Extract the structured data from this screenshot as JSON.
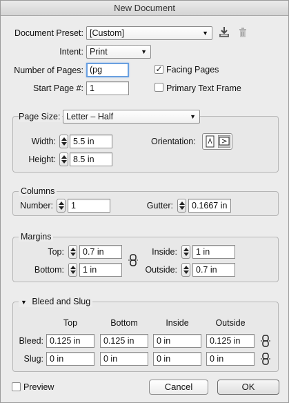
{
  "window": {
    "title": "New Document"
  },
  "preset": {
    "label": "Document Preset:",
    "value": "[Custom]"
  },
  "intent": {
    "label": "Intent:",
    "value": "Print"
  },
  "pages": {
    "label": "Number of Pages:",
    "value": "(pg count)"
  },
  "start_page": {
    "label": "Start Page #:",
    "value": "1"
  },
  "facing_pages": {
    "label": "Facing Pages",
    "checked": true
  },
  "primary_text_frame": {
    "label": "Primary Text Frame",
    "checked": false
  },
  "page_size": {
    "label": "Page Size:",
    "value": "Letter – Half",
    "width_label": "Width:",
    "width": "5.5 in",
    "height_label": "Height:",
    "height": "8.5 in",
    "orientation_label": "Orientation:"
  },
  "columns": {
    "legend": "Columns",
    "number_label": "Number:",
    "number": "1",
    "gutter_label": "Gutter:",
    "gutter": "0.1667 in"
  },
  "margins": {
    "legend": "Margins",
    "top_label": "Top:",
    "top": "0.7 in",
    "bottom_label": "Bottom:",
    "bottom": "1 in",
    "inside_label": "Inside:",
    "inside": "1 in",
    "outside_label": "Outside:",
    "outside": "0.7 in"
  },
  "bleed_slug": {
    "legend": "Bleed and Slug",
    "columns": [
      "Top",
      "Bottom",
      "Inside",
      "Outside"
    ],
    "bleed_label": "Bleed:",
    "bleed": [
      "0.125 in",
      "0.125 in",
      "0 in",
      "0.125 in"
    ],
    "slug_label": "Slug:",
    "slug": [
      "0 in",
      "0 in",
      "0 in",
      "0 in"
    ]
  },
  "preview": {
    "label": "Preview",
    "checked": false
  },
  "buttons": {
    "cancel": "Cancel",
    "ok": "OK"
  },
  "colors": {
    "focus_ring": "#6aa0e0",
    "window_bg": "#ececec"
  }
}
